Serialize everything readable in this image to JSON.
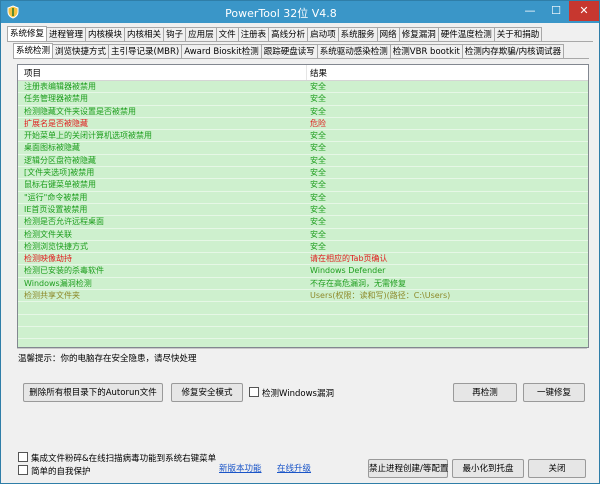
{
  "window": {
    "title": "PowerTool 32位 V4.8",
    "minimize": "—",
    "maximize": "☐",
    "close": "✕"
  },
  "main_tabs": [
    "系统修复",
    "进程管理",
    "内核模块",
    "内核相关",
    "钩子",
    "应用层",
    "文件",
    "注册表",
    "高线分析",
    "启动项",
    "系统服务",
    "网络",
    "修复漏洞",
    "硬件温度检测",
    "关于和捐助"
  ],
  "sub_tabs": [
    "系统检测",
    "浏览快捷方式",
    "主引导记录(MBR)",
    "Award Bioskit检测",
    "跟踪硬盘读写",
    "系统驱动感染检测",
    "检测VBR bootkit",
    "检测内存欺骗/内核调试器"
  ],
  "table": {
    "header_item": "项目",
    "header_result": "结果",
    "rows": [
      {
        "item": "注册表编辑器被禁用",
        "result": "安全",
        "item_status": "safe",
        "result_status": "safe"
      },
      {
        "item": "任务管理器被禁用",
        "result": "安全",
        "item_status": "safe",
        "result_status": "safe"
      },
      {
        "item": "检测隐藏文件夹设置是否被禁用",
        "result": "安全",
        "item_status": "safe",
        "result_status": "safe"
      },
      {
        "item": "扩展名是否被隐藏",
        "result": "危险",
        "item_status": "danger",
        "result_status": "danger"
      },
      {
        "item": "开始菜单上的关闭计算机选项被禁用",
        "result": "安全",
        "item_status": "safe",
        "result_status": "safe"
      },
      {
        "item": "桌面图标被隐藏",
        "result": "安全",
        "item_status": "safe",
        "result_status": "safe"
      },
      {
        "item": "逻辑分区盘符被隐藏",
        "result": "安全",
        "item_status": "safe",
        "result_status": "safe"
      },
      {
        "item": "[文件夹选项]被禁用",
        "result": "安全",
        "item_status": "safe",
        "result_status": "safe"
      },
      {
        "item": "鼠标右键菜单被禁用",
        "result": "安全",
        "item_status": "safe",
        "result_status": "safe"
      },
      {
        "item": "\"运行\"命令被禁用",
        "result": "安全",
        "item_status": "safe",
        "result_status": "safe"
      },
      {
        "item": "IE首页设置被禁用",
        "result": "安全",
        "item_status": "safe",
        "result_status": "safe"
      },
      {
        "item": "检测是否允许远程桌面",
        "result": "安全",
        "item_status": "safe",
        "result_status": "safe"
      },
      {
        "item": "检测文件关联",
        "result": "安全",
        "item_status": "safe",
        "result_status": "safe"
      },
      {
        "item": "检测浏览快捷方式",
        "result": "安全",
        "item_status": "safe",
        "result_status": "safe"
      },
      {
        "item": "检测映像劫持",
        "result": "请在相应的Tab页确认",
        "item_status": "danger",
        "result_status": "danger"
      },
      {
        "item": "检测已安装的杀毒软件",
        "result": "Windows Defender",
        "item_status": "safe",
        "result_status": "safe"
      },
      {
        "item": "Windows漏洞检测",
        "result": "不存在高危漏洞，无需修复",
        "item_status": "safe",
        "result_status": "safe"
      },
      {
        "item": "检测共享文件夹",
        "result": "Users(权限：读和写)(路径：C:\\Users)",
        "item_status": "olive",
        "result_status": "olive"
      },
      {
        "item": "",
        "result": "",
        "item_status": "safe",
        "result_status": "safe"
      },
      {
        "item": "",
        "result": "",
        "item_status": "safe",
        "result_status": "safe"
      },
      {
        "item": "",
        "result": "",
        "item_status": "safe",
        "result_status": "safe"
      },
      {
        "item": "",
        "result": "",
        "item_status": "safe",
        "result_status": "safe"
      },
      {
        "item": "",
        "result": "",
        "item_status": "safe",
        "result_status": "safe"
      }
    ]
  },
  "hint": "温馨提示：你的电脑存在安全隐患，请尽快处理",
  "buttons": {
    "delete_autorun": "删除所有根目录下的Autorun文件",
    "repair_safe_mode": "修复安全模式",
    "recheck": "再检测",
    "one_click_repair": "一键修复",
    "disable_hotkeys": "禁止进程创建/等配置",
    "bottom_right_1": "最小化到托盘",
    "bottom_right_2": "关闭"
  },
  "checkboxes": {
    "check_windows_vuln": "检测Windows漏洞",
    "integrate_context_menu": "集成文件粉碎&在线扫描病毒功能到系统右键菜单",
    "self_protect": "简单的自我保护"
  },
  "links": {
    "new_version": "新版本功能",
    "online_upgrade": "在线升级"
  },
  "colors": {
    "titlebar": "#3a96c8",
    "row_bg": "#cef0ce",
    "safe": "#1e9e1e",
    "danger": "#e02020",
    "olive": "#8d8a2a"
  }
}
